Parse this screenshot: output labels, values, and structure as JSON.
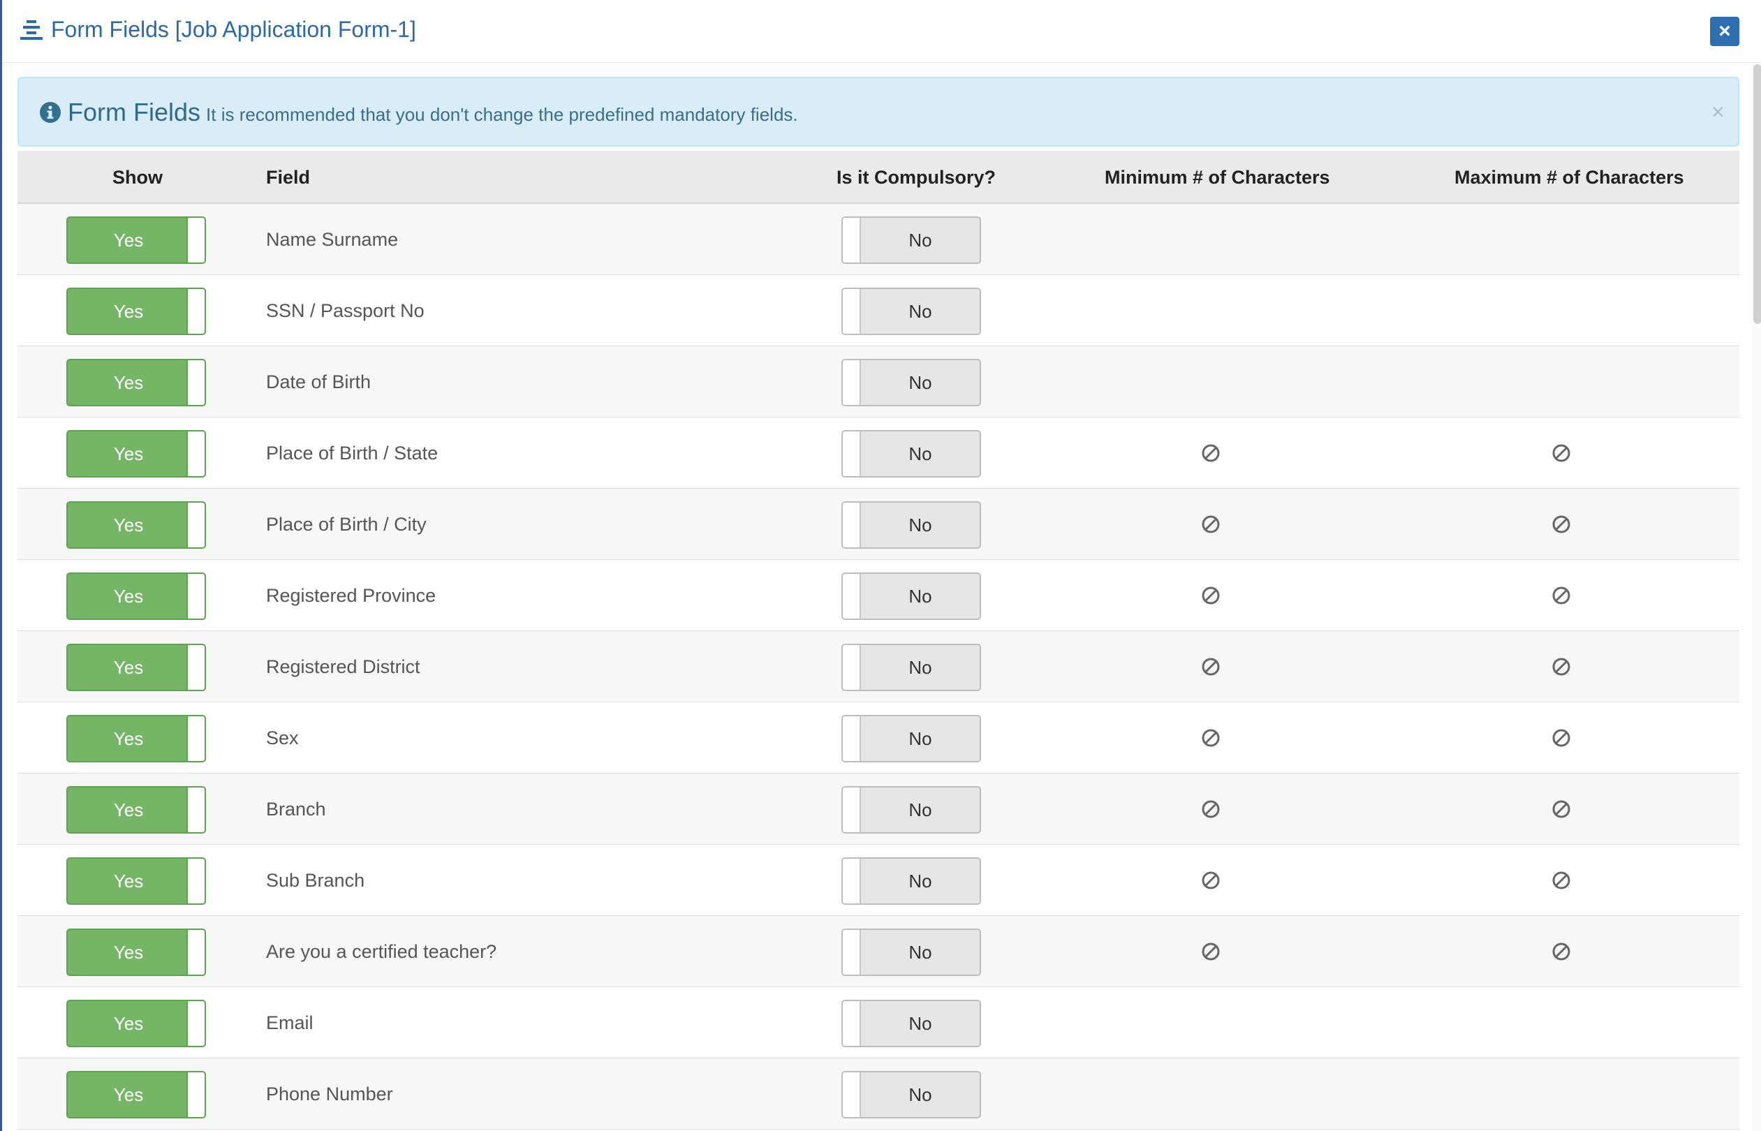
{
  "header": {
    "title": "Form Fields [Job Application Form-1]",
    "close_label": "×"
  },
  "alert": {
    "title": "Form Fields",
    "message": "It is recommended that you don't change the predefined mandatory fields.",
    "close_label": "×"
  },
  "table": {
    "columns": {
      "show": "Show",
      "field": "Field",
      "compulsory": "Is it Compulsory?",
      "min_chars": "Minimum # of Characters",
      "max_chars": "Maximum # of Characters"
    },
    "rows": [
      {
        "show": "Yes",
        "field": "Name Surname",
        "compulsory": "No",
        "limits_disabled": false
      },
      {
        "show": "Yes",
        "field": "SSN / Passport No",
        "compulsory": "No",
        "limits_disabled": false
      },
      {
        "show": "Yes",
        "field": "Date of Birth",
        "compulsory": "No",
        "limits_disabled": false
      },
      {
        "show": "Yes",
        "field": "Place of Birth / State",
        "compulsory": "No",
        "limits_disabled": true
      },
      {
        "show": "Yes",
        "field": "Place of Birth / City",
        "compulsory": "No",
        "limits_disabled": true
      },
      {
        "show": "Yes",
        "field": "Registered Province",
        "compulsory": "No",
        "limits_disabled": true
      },
      {
        "show": "Yes",
        "field": "Registered District",
        "compulsory": "No",
        "limits_disabled": true
      },
      {
        "show": "Yes",
        "field": "Sex",
        "compulsory": "No",
        "limits_disabled": true
      },
      {
        "show": "Yes",
        "field": "Branch",
        "compulsory": "No",
        "limits_disabled": true
      },
      {
        "show": "Yes",
        "field": "Sub Branch",
        "compulsory": "No",
        "limits_disabled": true
      },
      {
        "show": "Yes",
        "field": "Are you a certified teacher?",
        "compulsory": "No",
        "limits_disabled": true
      },
      {
        "show": "Yes",
        "field": "Email",
        "compulsory": "No",
        "limits_disabled": false
      },
      {
        "show": "Yes",
        "field": "Phone Number",
        "compulsory": "No",
        "limits_disabled": false
      }
    ]
  },
  "icons": {
    "header": "list-icon",
    "alert": "info-circle-icon",
    "disabled": "ban-icon"
  },
  "colors": {
    "accent": "#2b6aa6",
    "toggle_on": "#74b566",
    "toggle_off": "#e6e6e6",
    "alert_bg": "#d9edf7"
  }
}
